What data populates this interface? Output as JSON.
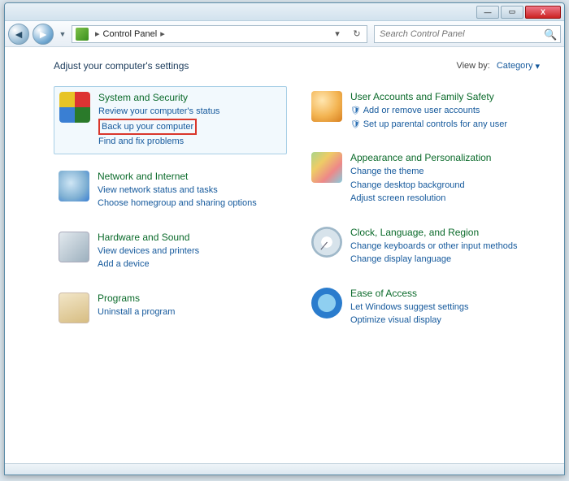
{
  "window": {
    "min": "—",
    "max": "▭",
    "close": "X"
  },
  "nav": {
    "back": "◄",
    "forward": "►",
    "dropdown": "▼",
    "breadcrumb_root": "Control Panel",
    "breadcrumb_sep": "▸",
    "refresh": "↻",
    "dd2": "▾"
  },
  "search": {
    "placeholder": "Search Control Panel",
    "icon": "🔍"
  },
  "heading": "Adjust your computer's settings",
  "viewby": {
    "label": "View by:",
    "value": "Category",
    "caret": "▾"
  },
  "left": [
    {
      "title": "System and Security",
      "links": [
        {
          "text": "Review your computer's status",
          "shield": false,
          "boxed": false
        },
        {
          "text": "Back up your computer",
          "shield": false,
          "boxed": true
        },
        {
          "text": "Find and fix problems",
          "shield": false,
          "boxed": false
        }
      ],
      "icon": "ic-security",
      "highlight": true
    },
    {
      "title": "Network and Internet",
      "links": [
        {
          "text": "View network status and tasks"
        },
        {
          "text": "Choose homegroup and sharing options"
        }
      ],
      "icon": "ic-network"
    },
    {
      "title": "Hardware and Sound",
      "links": [
        {
          "text": "View devices and printers"
        },
        {
          "text": "Add a device"
        }
      ],
      "icon": "ic-hardware"
    },
    {
      "title": "Programs",
      "links": [
        {
          "text": "Uninstall a program"
        }
      ],
      "icon": "ic-programs"
    }
  ],
  "right": [
    {
      "title": "User Accounts and Family Safety",
      "links": [
        {
          "text": "Add or remove user accounts",
          "shield": true
        },
        {
          "text": "Set up parental controls for any user",
          "shield": true
        }
      ],
      "icon": "ic-users"
    },
    {
      "title": "Appearance and Personalization",
      "links": [
        {
          "text": "Change the theme"
        },
        {
          "text": "Change desktop background"
        },
        {
          "text": "Adjust screen resolution"
        }
      ],
      "icon": "ic-appearance"
    },
    {
      "title": "Clock, Language, and Region",
      "links": [
        {
          "text": "Change keyboards or other input methods"
        },
        {
          "text": "Change display language"
        }
      ],
      "icon": "ic-clock"
    },
    {
      "title": "Ease of Access",
      "links": [
        {
          "text": "Let Windows suggest settings"
        },
        {
          "text": "Optimize visual display"
        }
      ],
      "icon": "ic-ease"
    }
  ]
}
